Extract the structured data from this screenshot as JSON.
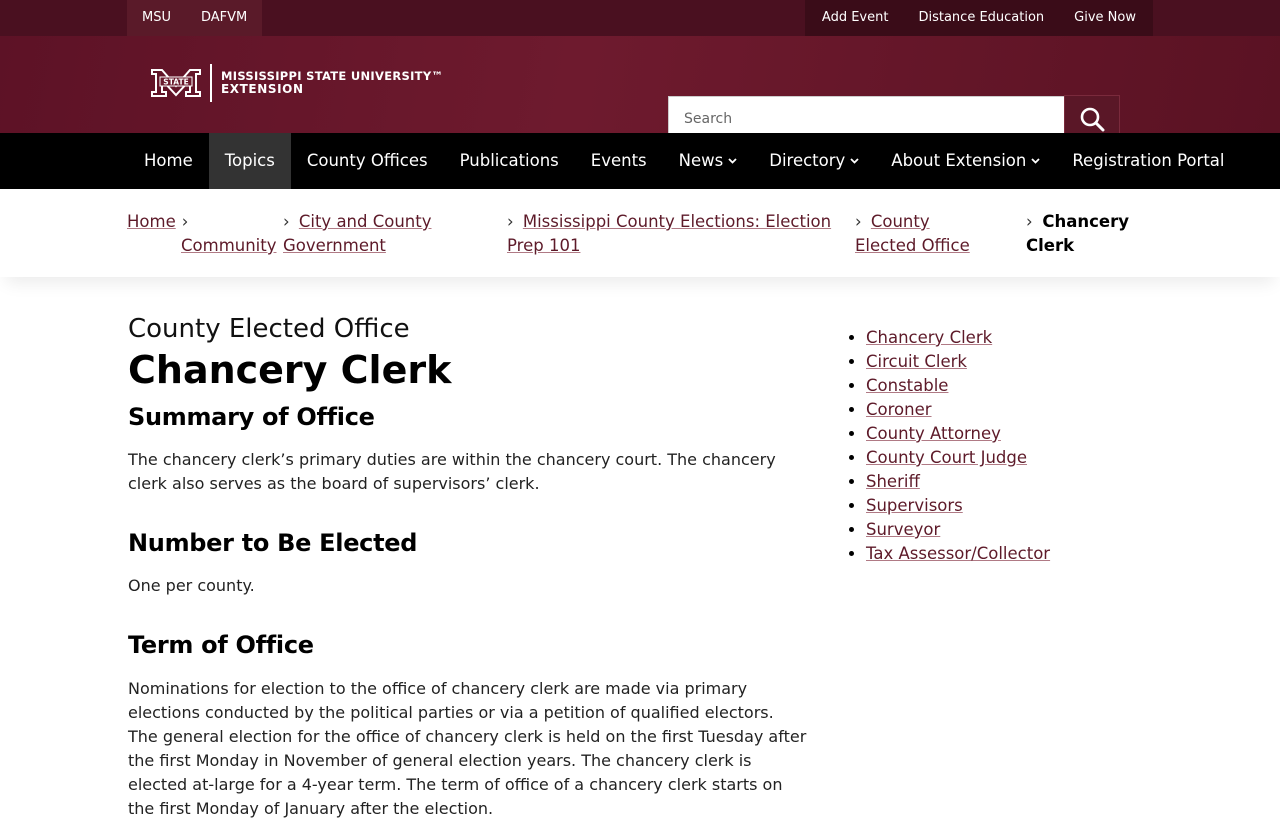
{
  "utility": {
    "left_links": [
      "MSU",
      "DAFVM"
    ],
    "right_links": [
      "Add Event",
      "Distance Education",
      "Give Now"
    ]
  },
  "header": {
    "logo_line1": "MISSISSIPPI STATE UNIVERSITY™",
    "logo_line2": "EXTENSION",
    "logo_mark": "MSU M STATE logo",
    "search_placeholder": "Search",
    "search_icon": "search-icon"
  },
  "nav": {
    "items": [
      {
        "label": "Home",
        "dropdown": false
      },
      {
        "label": "Topics",
        "dropdown": false,
        "active": true
      },
      {
        "label": "County Offices",
        "dropdown": false
      },
      {
        "label": "Publications",
        "dropdown": false
      },
      {
        "label": "Events",
        "dropdown": false
      },
      {
        "label": "News",
        "dropdown": true
      },
      {
        "label": "Directory",
        "dropdown": true
      },
      {
        "label": "About Extension",
        "dropdown": true
      },
      {
        "label": "Registration Portal",
        "dropdown": false
      }
    ]
  },
  "breadcrumb": {
    "items": [
      {
        "label": "Home"
      },
      {
        "label": "Community"
      },
      {
        "label": "City and County Government"
      },
      {
        "label": "Mississippi County Elections: Election Prep 101"
      },
      {
        "label": "County Elected Office"
      },
      {
        "label": "Chancery Clerk",
        "current": true
      }
    ],
    "separator": "›"
  },
  "main": {
    "eyebrow": "County Elected Office",
    "title": "Chancery Clerk",
    "sections": [
      {
        "heading": "Summary of Office",
        "body": "The chancery clerk’s primary duties are within the chancery court. The chancery clerk also serves as the board of supervisors’ clerk."
      },
      {
        "heading": "Number to Be Elected",
        "body": "One per county."
      },
      {
        "heading": "Term of Office",
        "body": "Nominations for election to the office of chancery clerk are made via primary elections conducted by the political parties or via a petition of qualified electors. The general election for the office of chancery clerk is held on the first Tuesday after the first Monday in November of general election years. The chancery clerk is elected at-large for a 4-year term. The term of office of a chancery clerk starts on the first Monday of January after the election."
      }
    ]
  },
  "sidebar": {
    "links": [
      "Chancery Clerk",
      "Circuit Clerk",
      "Constable",
      "Coroner",
      "County Attorney",
      "County Court Judge",
      "Sheriff",
      "Supervisors",
      "Surveyor",
      "Tax Assessor/Collector"
    ]
  },
  "colors": {
    "maroon": "#5d1a29",
    "utility_bar": "#4a1020",
    "nav_bg": "#000000",
    "nav_active": "#333333"
  }
}
